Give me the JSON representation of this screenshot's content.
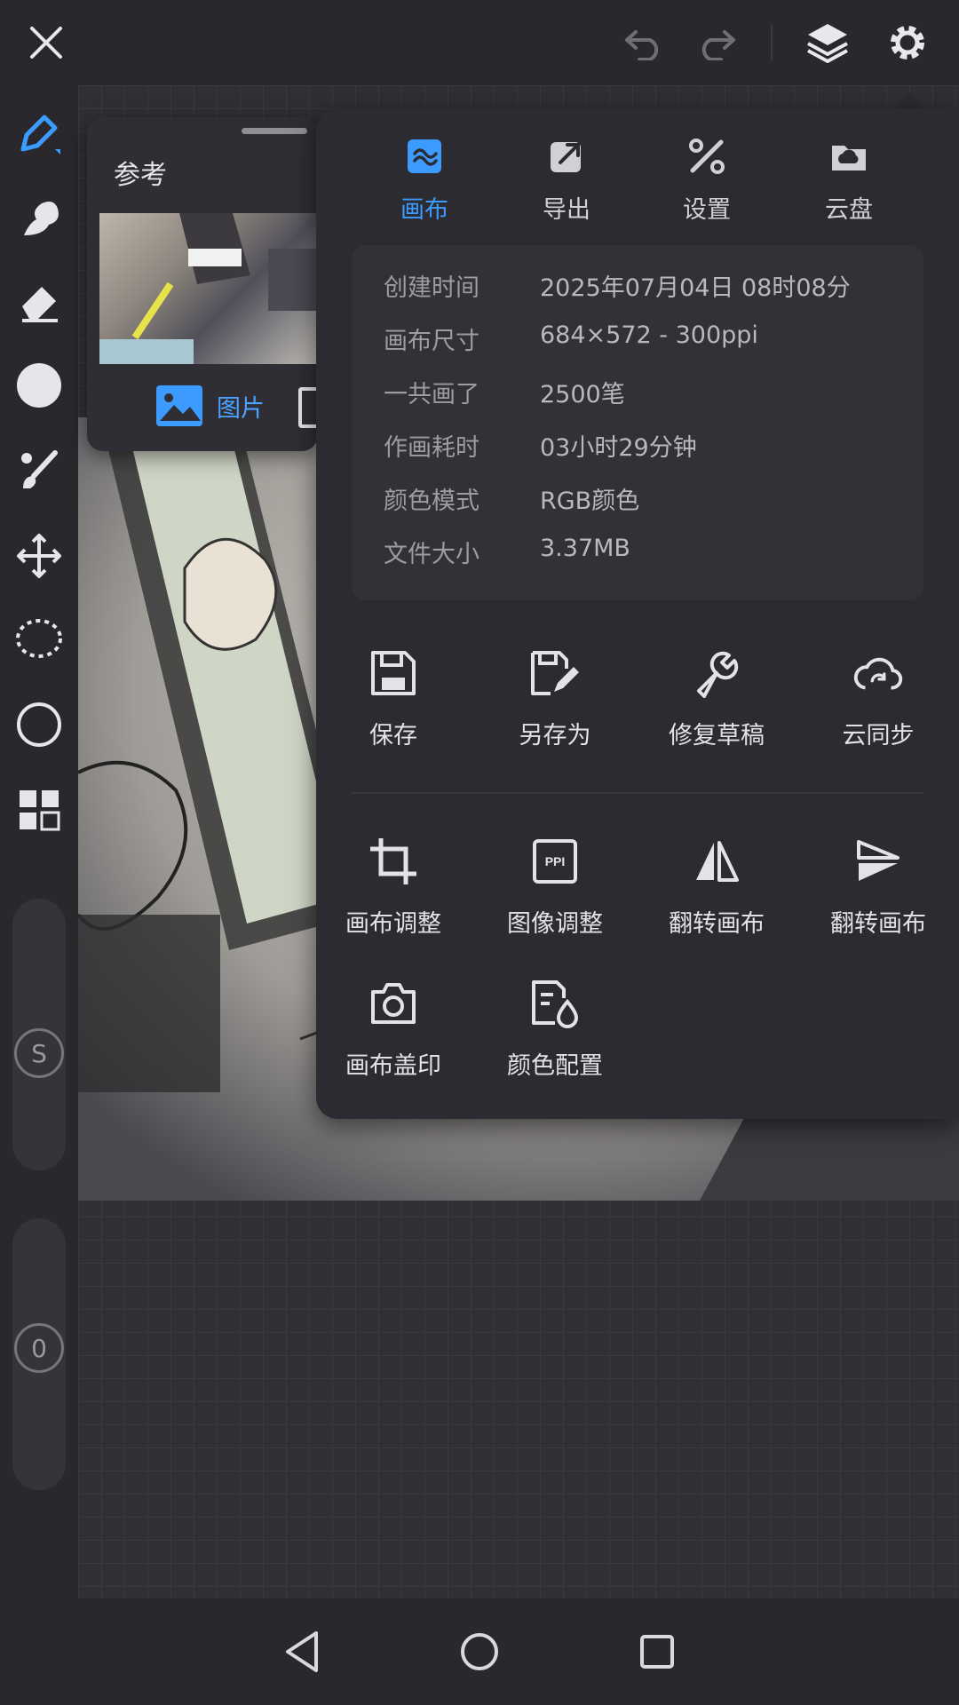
{
  "colors": {
    "accent": "#3b9bff",
    "panel": "#2c2b31",
    "background": "#29282d"
  },
  "topbar": {
    "icons": [
      "close-icon",
      "undo-icon",
      "redo-icon",
      "layers-icon",
      "gear-icon"
    ]
  },
  "toolbar": {
    "icons": [
      "pen-icon",
      "smudge-icon",
      "eraser-icon",
      "color-icon",
      "brush-adjust-icon",
      "move-icon",
      "lasso-icon",
      "shape-icon",
      "grid-icon"
    ],
    "size_slider_label": "S",
    "opacity_slider_label": "0"
  },
  "reference": {
    "title": "参考",
    "tab_image": "图片"
  },
  "menu": {
    "tabs": [
      {
        "label": "画布",
        "icon": "canvas-icon",
        "active": true
      },
      {
        "label": "导出",
        "icon": "export-icon",
        "active": false
      },
      {
        "label": "设置",
        "icon": "settings-tools-icon",
        "active": false
      },
      {
        "label": "云盘",
        "icon": "cloud-drive-icon",
        "active": false
      }
    ],
    "info": [
      {
        "label": "创建时间",
        "value": "2025年07月04日 08时08分"
      },
      {
        "label": "画布尺寸",
        "value": "684×572 - 300ppi"
      },
      {
        "label": "一共画了",
        "value": "2500笔"
      },
      {
        "label": "作画耗时",
        "value": "03小时29分钟"
      },
      {
        "label": "颜色模式",
        "value": "RGB颜色"
      },
      {
        "label": "文件大小",
        "value": "3.37MB"
      }
    ],
    "actions_row1": [
      {
        "label": "保存",
        "icon": "save-icon"
      },
      {
        "label": "另存为",
        "icon": "save-as-icon"
      },
      {
        "label": "修复草稿",
        "icon": "wrench-icon"
      },
      {
        "label": "云同步",
        "icon": "cloud-sync-icon"
      }
    ],
    "actions_row2": [
      {
        "label": "画布调整",
        "icon": "crop-icon"
      },
      {
        "label": "图像调整",
        "icon": "ppi-icon",
        "icon_text": "PPI"
      },
      {
        "label": "翻转画布",
        "icon": "flip-horizontal-icon"
      },
      {
        "label": "翻转画布",
        "icon": "flip-vertical-icon"
      }
    ],
    "actions_row3": [
      {
        "label": "画布盖印",
        "icon": "camera-icon"
      },
      {
        "label": "颜色配置",
        "icon": "color-profile-icon"
      }
    ]
  },
  "navbar": {
    "icons": [
      "back-icon",
      "home-icon",
      "recents-icon"
    ]
  }
}
